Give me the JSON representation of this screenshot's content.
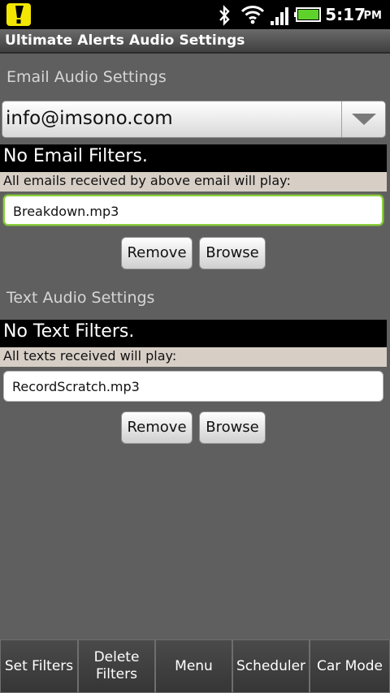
{
  "status_bar": {
    "time": "5:17",
    "ampm": "PM"
  },
  "title": "Ultimate Alerts Audio Settings",
  "email": {
    "section_label": "Email Audio Settings",
    "account_selected": "info@imsono.com",
    "filters_text": "No Email Filters.",
    "info_text": "All emails received by above email will play:",
    "file_value": "Breakdown.mp3",
    "remove_label": "Remove",
    "browse_label": "Browse"
  },
  "text": {
    "section_label": "Text Audio Settings",
    "filters_text": "No Text Filters.",
    "info_text": "All texts received will play:",
    "file_value": "RecordScratch.mp3",
    "remove_label": "Remove",
    "browse_label": "Browse"
  },
  "tabs": [
    {
      "label": "Set Filters"
    },
    {
      "label": "Delete Filters"
    },
    {
      "label": "Menu"
    },
    {
      "label": "Scheduler"
    },
    {
      "label": "Car Mode"
    }
  ],
  "colors": {
    "focus_accent": "#8ccf3c",
    "notification_yellow": "#f3e600",
    "battery_green": "#5fd12b"
  },
  "icons": [
    "alert-notification-icon",
    "bluetooth-icon",
    "wifi-icon",
    "signal-icon",
    "battery-icon",
    "dropdown-arrow-icon"
  ]
}
